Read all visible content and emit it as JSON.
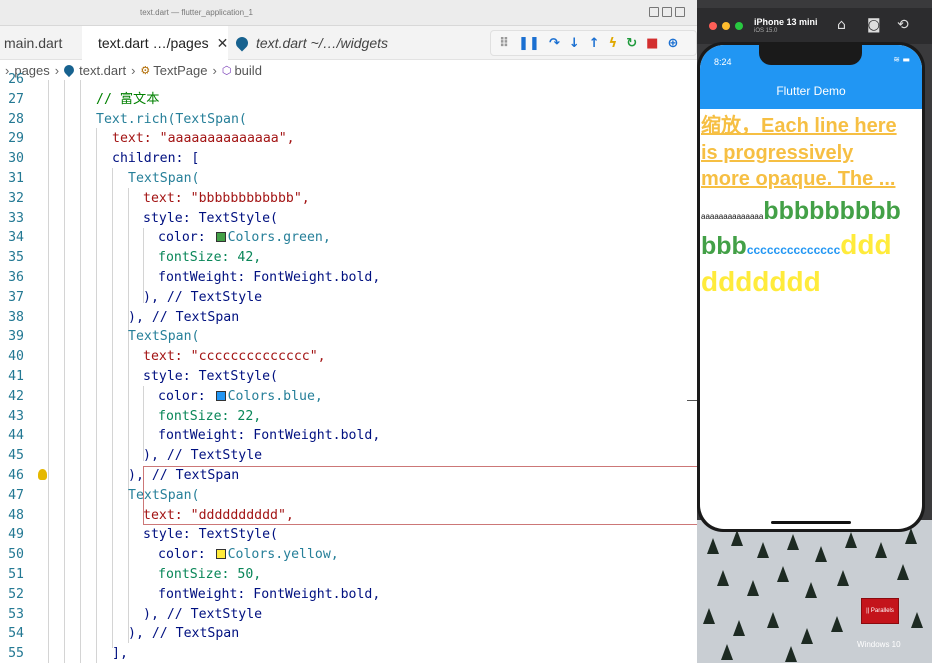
{
  "window": {
    "title": "text.dart — flutter_application_1"
  },
  "tabs": [
    {
      "label": "main.dart"
    },
    {
      "label": "text.dart",
      "detail": "…/pages",
      "close": "✕"
    },
    {
      "label": "text.dart",
      "detail": "~/…/widgets"
    }
  ],
  "breadcrumb": {
    "items": [
      "pages",
      "text.dart",
      "TextPage",
      "build"
    ],
    "separator": "›",
    "prefix": "›"
  },
  "debug_toolbar": {
    "icons": [
      "drag-handle-icon",
      "pause-icon",
      "step-over-icon",
      "step-into-icon",
      "step-out-icon",
      "hot-reload-icon",
      "hot-restart-icon",
      "stop-icon",
      "inspector-icon"
    ]
  },
  "editor": {
    "lines": [
      {
        "n": "26",
        "text": ""
      },
      {
        "n": "27",
        "text": "// 富文本"
      },
      {
        "n": "28",
        "text": "Text.rich(TextSpan("
      },
      {
        "n": "29",
        "text": "text: \"aaaaaaaaaaaaaa\","
      },
      {
        "n": "30",
        "text": "children: ["
      },
      {
        "n": "31",
        "text": "TextSpan("
      },
      {
        "n": "32",
        "text": "text: \"bbbbbbbbbbbb\","
      },
      {
        "n": "33",
        "text": "style: TextStyle("
      },
      {
        "n": "34",
        "text": "color: Colors.green,"
      },
      {
        "n": "35",
        "text": "fontSize: 42,"
      },
      {
        "n": "36",
        "text": "fontWeight: FontWeight.bold,"
      },
      {
        "n": "37",
        "text": "), // TextStyle"
      },
      {
        "n": "38",
        "text": "), // TextSpan"
      },
      {
        "n": "39",
        "text": "TextSpan("
      },
      {
        "n": "40",
        "text": "text: \"cccccccccccccc\","
      },
      {
        "n": "41",
        "text": "style: TextStyle("
      },
      {
        "n": "42",
        "text": "color: Colors.blue,"
      },
      {
        "n": "43",
        "text": "fontSize: 22,"
      },
      {
        "n": "44",
        "text": "fontWeight: FontWeight.bold,"
      },
      {
        "n": "45",
        "text": "), // TextStyle"
      },
      {
        "n": "46",
        "text": "), // TextSpan"
      },
      {
        "n": "47",
        "text": "TextSpan("
      },
      {
        "n": "48",
        "text": "text: \"dddddddddd\","
      },
      {
        "n": "49",
        "text": "style: TextStyle("
      },
      {
        "n": "50",
        "text": "color: Colors.yellow,"
      },
      {
        "n": "51",
        "text": "fontSize: 50,"
      },
      {
        "n": "52",
        "text": "fontWeight: FontWeight.bold,"
      },
      {
        "n": "53",
        "text": "), // TextStyle"
      },
      {
        "n": "54",
        "text": "), // TextSpan"
      },
      {
        "n": "55",
        "text": "],"
      }
    ]
  },
  "simulator": {
    "device": "iPhone 13 mini",
    "os": "iOS 15.0",
    "status_time": "8:24",
    "app_title": "Flutter Demo",
    "text_lines": [
      "缩放，Each line here",
      "is progressively",
      "more opaque. The ..."
    ],
    "rich": {
      "a": "aaaaaaaaaaaaaa",
      "b1": "bbbbbbbbb",
      "b2": "bbb",
      "c": "cccccccccccccc",
      "d1": "ddd",
      "d2": "ddddddd"
    },
    "colors": {
      "app_bar": "#2196f3",
      "yellow_text": "#f6bf43",
      "green": "#43a047",
      "blue": "#2196f3",
      "yellow": "#ffeb3b"
    }
  },
  "desktop": {
    "parallels_label": "|| Parallels",
    "windows_label": "Windows 10"
  }
}
